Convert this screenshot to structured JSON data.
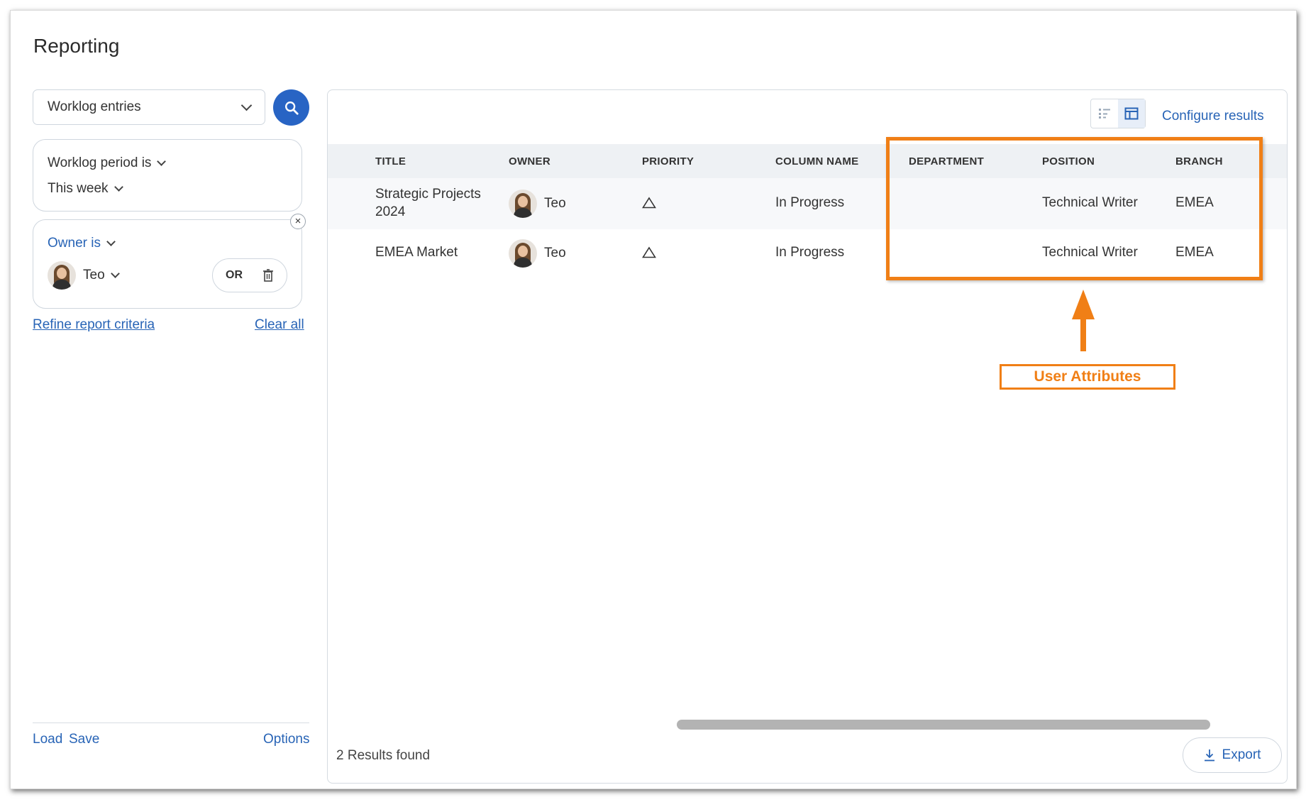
{
  "page": {
    "title": "Reporting"
  },
  "sidebar": {
    "report_type": "Worklog entries",
    "filters": {
      "period_label": "Worklog period is",
      "period_value": "This week",
      "owner_label": "Owner is",
      "owner_value": "Teo",
      "or_label": "OR"
    },
    "refine_link": "Refine report criteria",
    "clear_link": "Clear all",
    "footer": {
      "load": "Load",
      "save": "Save",
      "options": "Options"
    }
  },
  "main": {
    "configure_link": "Configure results",
    "columns": [
      "TITLE",
      "OWNER",
      "PRIORITY",
      "COLUMN NAME",
      "DEPARTMENT",
      "POSITION",
      "BRANCH"
    ],
    "rows": [
      {
        "title_line1": "Strategic Projects",
        "title_line2": "2024",
        "owner": "Teo",
        "column_name": "In Progress",
        "department": "",
        "position": "Technical Writer",
        "branch": "EMEA"
      },
      {
        "title_line1": "EMEA Market",
        "title_line2": "",
        "owner": "Teo",
        "column_name": "In Progress",
        "department": "",
        "position": "Technical Writer",
        "branch": "EMEA"
      }
    ],
    "results_text": "2 Results found",
    "export_label": "Export"
  },
  "annotation": {
    "label": "User Attributes",
    "color": "#f07f16"
  },
  "colors": {
    "accent": "#2864c4",
    "link": "#2864b6"
  },
  "icons": [
    "chevron-down-icon",
    "search-icon",
    "close-icon",
    "trash-icon",
    "list-view-icon",
    "table-view-icon",
    "priority-triangle-icon",
    "download-icon"
  ]
}
